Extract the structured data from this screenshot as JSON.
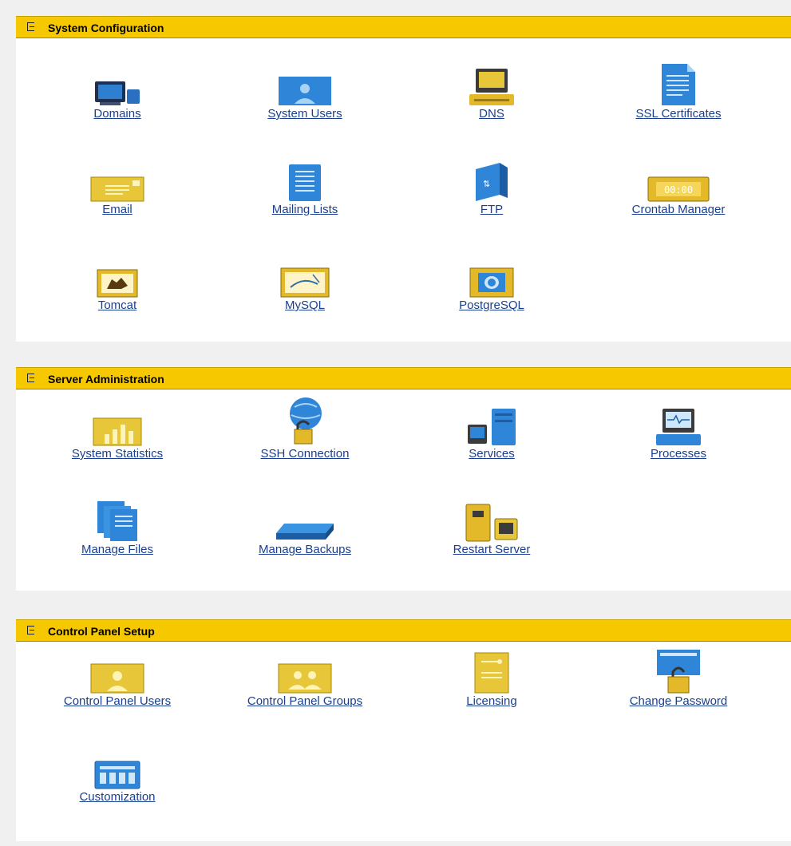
{
  "colors": {
    "header_bg": "#f5c800",
    "link": "#1a3f8f",
    "page_bg": "#f0f0f0",
    "panel_bg": "#ffffff"
  },
  "sections": [
    {
      "title": "System Configuration",
      "items": [
        {
          "label": "Domains",
          "icon": "domains-icon"
        },
        {
          "label": "System Users",
          "icon": "system-users-icon"
        },
        {
          "label": "DNS",
          "icon": "dns-icon"
        },
        {
          "label": "SSL Certificates",
          "icon": "ssl-certificate-icon"
        },
        {
          "label": "Email",
          "icon": "email-envelope-icon"
        },
        {
          "label": "Mailing Lists",
          "icon": "mailing-lists-icon"
        },
        {
          "label": "FTP",
          "icon": "ftp-icon"
        },
        {
          "label": "Crontab Manager",
          "icon": "crontab-clock-icon",
          "icon_text": "00:00"
        },
        {
          "label": "Tomcat",
          "icon": "tomcat-logo-icon"
        },
        {
          "label": "MySQL",
          "icon": "mysql-logo-icon"
        },
        {
          "label": "PostgreSQL",
          "icon": "postgresql-logo-icon"
        }
      ]
    },
    {
      "title": "Server Administration",
      "items": [
        {
          "label": "System Statistics",
          "icon": "bar-chart-icon"
        },
        {
          "label": "SSH Connection",
          "icon": "globe-lock-icon"
        },
        {
          "label": "Services",
          "icon": "server-monitor-icon"
        },
        {
          "label": "Processes",
          "icon": "process-monitor-icon"
        },
        {
          "label": "Manage Files",
          "icon": "files-icon"
        },
        {
          "label": "Manage Backups",
          "icon": "backup-drive-icon"
        },
        {
          "label": "Restart Server",
          "icon": "restart-server-icon"
        }
      ]
    },
    {
      "title": "Control Panel Setup",
      "items": [
        {
          "label": "Control Panel Users",
          "icon": "cp-user-icon"
        },
        {
          "label": "Control Panel Groups",
          "icon": "cp-group-icon"
        },
        {
          "label": "Licensing",
          "icon": "license-document-icon"
        },
        {
          "label": "Change Password",
          "icon": "password-lock-icon"
        },
        {
          "label": "Customization",
          "icon": "customization-keyboard-icon"
        }
      ]
    }
  ]
}
